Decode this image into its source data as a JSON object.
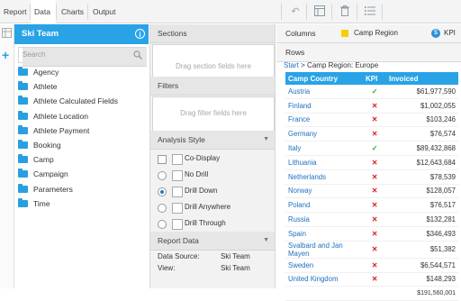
{
  "toolbar": {
    "tabs": [
      "Report",
      "Data",
      "Charts",
      "Output"
    ],
    "active_tab": "Data",
    "icons": [
      "undo-icon",
      "table-layout-icon",
      "delete-icon",
      "list-icon"
    ]
  },
  "fields_panel": {
    "title": "Ski Team",
    "search_placeholder": "Search",
    "items": [
      "Agency",
      "Athlete",
      "Athlete Calculated Fields",
      "Athlete Location",
      "Athlete Payment",
      "Booking",
      "Camp",
      "Campaign",
      "Parameters",
      "Time"
    ]
  },
  "sections": {
    "title": "Sections",
    "placeholder": "Drag section fields here"
  },
  "filters": {
    "title": "Filters",
    "placeholder": "Drag filter fields here"
  },
  "analysis_style": {
    "title": "Analysis Style",
    "checkbox_label": "Co-Display",
    "options": [
      {
        "label": "No Drill",
        "selected": false
      },
      {
        "label": "Drill Down",
        "selected": true
      },
      {
        "label": "Drill Anywhere",
        "selected": false
      },
      {
        "label": "Drill Through",
        "selected": false
      }
    ]
  },
  "report_data": {
    "title": "Report Data",
    "data_source_label": "Data Source:",
    "data_source_value": "Ski Team",
    "view_label": "View:",
    "view_value": "Ski Team"
  },
  "columns": {
    "label": "Columns",
    "fields": [
      "Camp Region",
      "KPI"
    ],
    "colors": [
      "#f5d000",
      "#2a8fd9"
    ]
  },
  "rows": {
    "label": "Rows"
  },
  "breadcrumb": {
    "start": "Start",
    "sep": ">",
    "current": "Camp Region: Europe"
  },
  "table": {
    "headers": [
      "Camp Country",
      "KPI",
      "Invoiced"
    ],
    "rows": [
      {
        "country": "Austria",
        "kpi": "good",
        "invoiced": "$61,977,590"
      },
      {
        "country": "Finland",
        "kpi": "bad",
        "invoiced": "$1,002,055"
      },
      {
        "country": "France",
        "kpi": "bad",
        "invoiced": "$103,246"
      },
      {
        "country": "Germany",
        "kpi": "bad",
        "invoiced": "$76,574"
      },
      {
        "country": "Italy",
        "kpi": "good",
        "invoiced": "$89,432,868"
      },
      {
        "country": "Lithuania",
        "kpi": "bad",
        "invoiced": "$12,643,684"
      },
      {
        "country": "Netherlands",
        "kpi": "bad",
        "invoiced": "$78,539"
      },
      {
        "country": "Norway",
        "kpi": "bad",
        "invoiced": "$128,057"
      },
      {
        "country": "Poland",
        "kpi": "bad",
        "invoiced": "$76,517"
      },
      {
        "country": "Russia",
        "kpi": "bad",
        "invoiced": "$132,281"
      },
      {
        "country": "Spain",
        "kpi": "bad",
        "invoiced": "$346,493"
      },
      {
        "country": "Svalbard and Jan Mayen",
        "kpi": "bad",
        "invoiced": "$51,382"
      },
      {
        "country": "Sweden",
        "kpi": "bad",
        "invoiced": "$6,544,571"
      },
      {
        "country": "United Kingdom",
        "kpi": "bad",
        "invoiced": "$148,293"
      }
    ],
    "total": "$191,560,001",
    "symbols": {
      "good": "✓",
      "bad": "✕"
    }
  }
}
